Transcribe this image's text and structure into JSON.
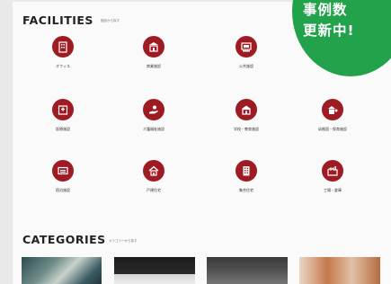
{
  "facilities": {
    "title": "FACILITIES",
    "subtitle": "施設から探す",
    "items": [
      {
        "label": "オフィス",
        "icon": "office-building-icon"
      },
      {
        "label": "商業施設",
        "icon": "shopping-store-icon"
      },
      {
        "label": "公共施設",
        "icon": "public-facility-icon"
      },
      {
        "label": "医療施設",
        "icon": "hospital-icon"
      },
      {
        "label": "介護福祉施設",
        "icon": "care-hand-icon"
      },
      {
        "label": "学校・教育施設",
        "icon": "school-icon"
      },
      {
        "label": "幼稚園・保育施設",
        "icon": "kindergarten-icon"
      },
      {
        "label": "宿泊施設",
        "icon": "hotel-bed-icon"
      },
      {
        "label": "戸建住宅",
        "icon": "house-icon"
      },
      {
        "label": "集合住宅",
        "icon": "apartment-icon"
      },
      {
        "label": "工場・倉庫",
        "icon": "factory-icon"
      }
    ]
  },
  "categories": {
    "title": "CATEGORIES",
    "subtitle": "カテゴリーから探す"
  },
  "badge": {
    "line1": "事例数",
    "line2": "更新中!"
  },
  "colors": {
    "accent": "#9e1b23",
    "badge": "#22a24a"
  }
}
